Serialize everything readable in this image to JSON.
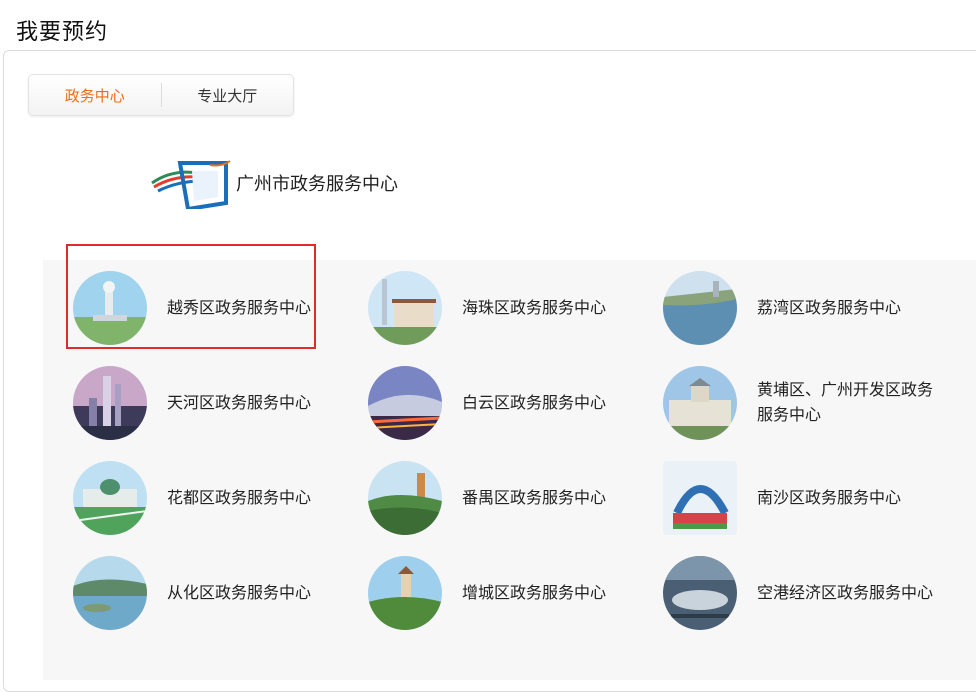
{
  "page": {
    "title": "我要预约"
  },
  "tabs": [
    {
      "label": "政务中心",
      "active": true
    },
    {
      "label": "专业大厅",
      "active": false
    }
  ],
  "center": {
    "name": "广州市政务服务中心"
  },
  "colors": {
    "accent": "#ee6d19",
    "highlight": "#e02b2b"
  },
  "centers": [
    {
      "label": "越秀区政务服务中心",
      "icon": "statue-photo"
    },
    {
      "label": "海珠区政务服务中心",
      "icon": "tower-photo"
    },
    {
      "label": "荔湾区政务服务中心",
      "icon": "river-photo"
    },
    {
      "label": "天河区政务服务中心",
      "icon": "skyline-photo"
    },
    {
      "label": "白云区政务服务中心",
      "icon": "airport-photo"
    },
    {
      "label": "黄埔区、广州开发区政务服务中心",
      "icon": "building-photo"
    },
    {
      "label": "花都区政务服务中心",
      "icon": "palace-photo"
    },
    {
      "label": "番禺区政务服务中心",
      "icon": "pagoda-photo"
    },
    {
      "label": "南沙区政务服务中心",
      "icon": "arch-photo"
    },
    {
      "label": "从化区政务服务中心",
      "icon": "lake-photo"
    },
    {
      "label": "增城区政务服务中心",
      "icon": "temple-photo"
    },
    {
      "label": "空港经济区政务服务中心",
      "icon": "terminal-photo"
    }
  ]
}
